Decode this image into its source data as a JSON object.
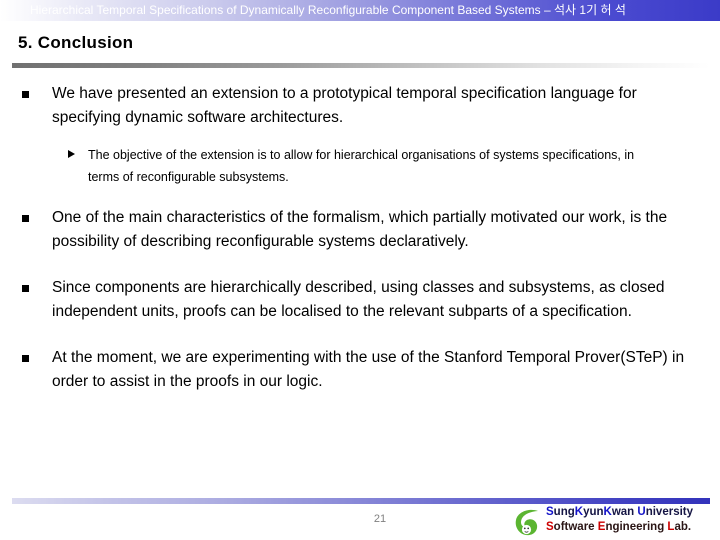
{
  "header": {
    "title": "Hierarchical Temporal Specifications of Dynamically Reconfigurable Component Based Systems – 석사 1기 허 석"
  },
  "slide": {
    "title": "5. Conclusion",
    "bullets": [
      {
        "marker": "square-bullet",
        "text": "We have presented an extension to a prototypical temporal specification language for specifying dynamic software architectures.",
        "sub": [
          {
            "marker": "triangle-bullet",
            "text": "The objective of the extension is to allow for hierarchical organisations of systems specifications, in terms of reconfigurable subsystems."
          }
        ]
      },
      {
        "marker": "square-bullet",
        "text": "One of the main characteristics of the formalism, which partially motivated our work, is the possibility of describing reconfigurable systems declaratively."
      },
      {
        "marker": "square-bullet",
        "text": "Since components are hierarchically described, using classes and subsystems, as closed independent units, proofs can be localised to the relevant subparts of a specification."
      },
      {
        "marker": "square-bullet",
        "text": "At the moment, we are experimenting with the use of the Stanford Temporal Prover(STeP) in order to assist in the proofs in our logic."
      }
    ]
  },
  "footer": {
    "page_number": "21",
    "organization": {
      "logo": "skku-leaf-logo",
      "line1_caps": [
        "S",
        "K",
        "K",
        "U"
      ],
      "line1": "SungKyunKwan University",
      "line2": "Software Engineering Lab.",
      "line1_parts": [
        {
          "text": "S",
          "highlight": true
        },
        {
          "text": "ung",
          "highlight": false
        },
        {
          "text": "K",
          "highlight": true
        },
        {
          "text": "yun",
          "highlight": false
        },
        {
          "text": "K",
          "highlight": true
        },
        {
          "text": "wan ",
          "highlight": false
        },
        {
          "text": "U",
          "highlight": true
        },
        {
          "text": "niversity",
          "highlight": false
        }
      ],
      "line2_parts": [
        {
          "text": "S",
          "highlight": true
        },
        {
          "text": "oftware ",
          "highlight": false
        },
        {
          "text": "E",
          "highlight": true
        },
        {
          "text": "ngineering ",
          "highlight": false
        },
        {
          "text": "L",
          "highlight": true
        },
        {
          "text": "ab.",
          "highlight": false
        }
      ]
    }
  },
  "colors": {
    "header_gradient_end": "#3b3bc8",
    "footer_gradient_end": "#3333bb",
    "title_rule_start": "#808080",
    "accent_blue": "#1414c8",
    "accent_red": "#cc0000",
    "logo_green": "#5bb531",
    "page_number_gray": "#808080"
  }
}
